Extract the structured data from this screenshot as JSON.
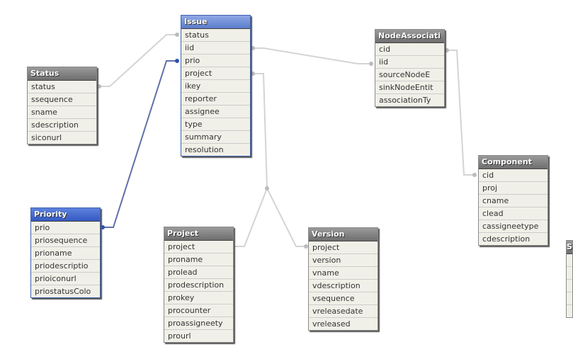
{
  "colors": {
    "title": "#7a7a7a",
    "selected_title": "#6f8fd8",
    "row_bg": "#f1f0e8",
    "link": "#d0d0d0",
    "selected_link": "#6070a8"
  },
  "tables": [
    {
      "id": "issue",
      "name": "Issue",
      "cls": "sel",
      "fields": [
        "status",
        "iid",
        "prio",
        "project",
        "ikey",
        "reporter",
        "assignee",
        "type",
        "summary",
        "resolution"
      ]
    },
    {
      "id": "status",
      "name": "Status",
      "cls": "",
      "fields": [
        "status",
        "ssequence",
        "sname",
        "sdescription",
        "siconurl"
      ]
    },
    {
      "id": "priority",
      "name": "Priority",
      "cls": "sel2",
      "fields": [
        "prio",
        "priosequence",
        "prioname",
        "priodescriptio",
        "prioiconurl",
        "priostatusColo"
      ]
    },
    {
      "id": "project",
      "name": "Project",
      "cls": "",
      "fields": [
        "project",
        "proname",
        "prolead",
        "prodescription",
        "prokey",
        "procounter",
        "proassigneety",
        "prourl"
      ]
    },
    {
      "id": "version",
      "name": "Version",
      "cls": "",
      "fields": [
        "project",
        "version",
        "vname",
        "vdescription",
        "vsequence",
        "vreleasedate",
        "vreleased"
      ]
    },
    {
      "id": "nodeassociation",
      "name": "NodeAssociati",
      "cls": "",
      "fields": [
        "cid",
        "iid",
        "sourceNodeE",
        "sinkNodeEntit",
        "associationTy"
      ]
    },
    {
      "id": "component",
      "name": "Component",
      "cls": "",
      "fields": [
        "cid",
        "proj",
        "cname",
        "clead",
        "cassigneetype",
        "cdescription"
      ]
    },
    {
      "id": "partial",
      "name": "S",
      "cls": "",
      "fields": [
        "",
        "",
        "",
        "",
        ""
      ]
    }
  ]
}
